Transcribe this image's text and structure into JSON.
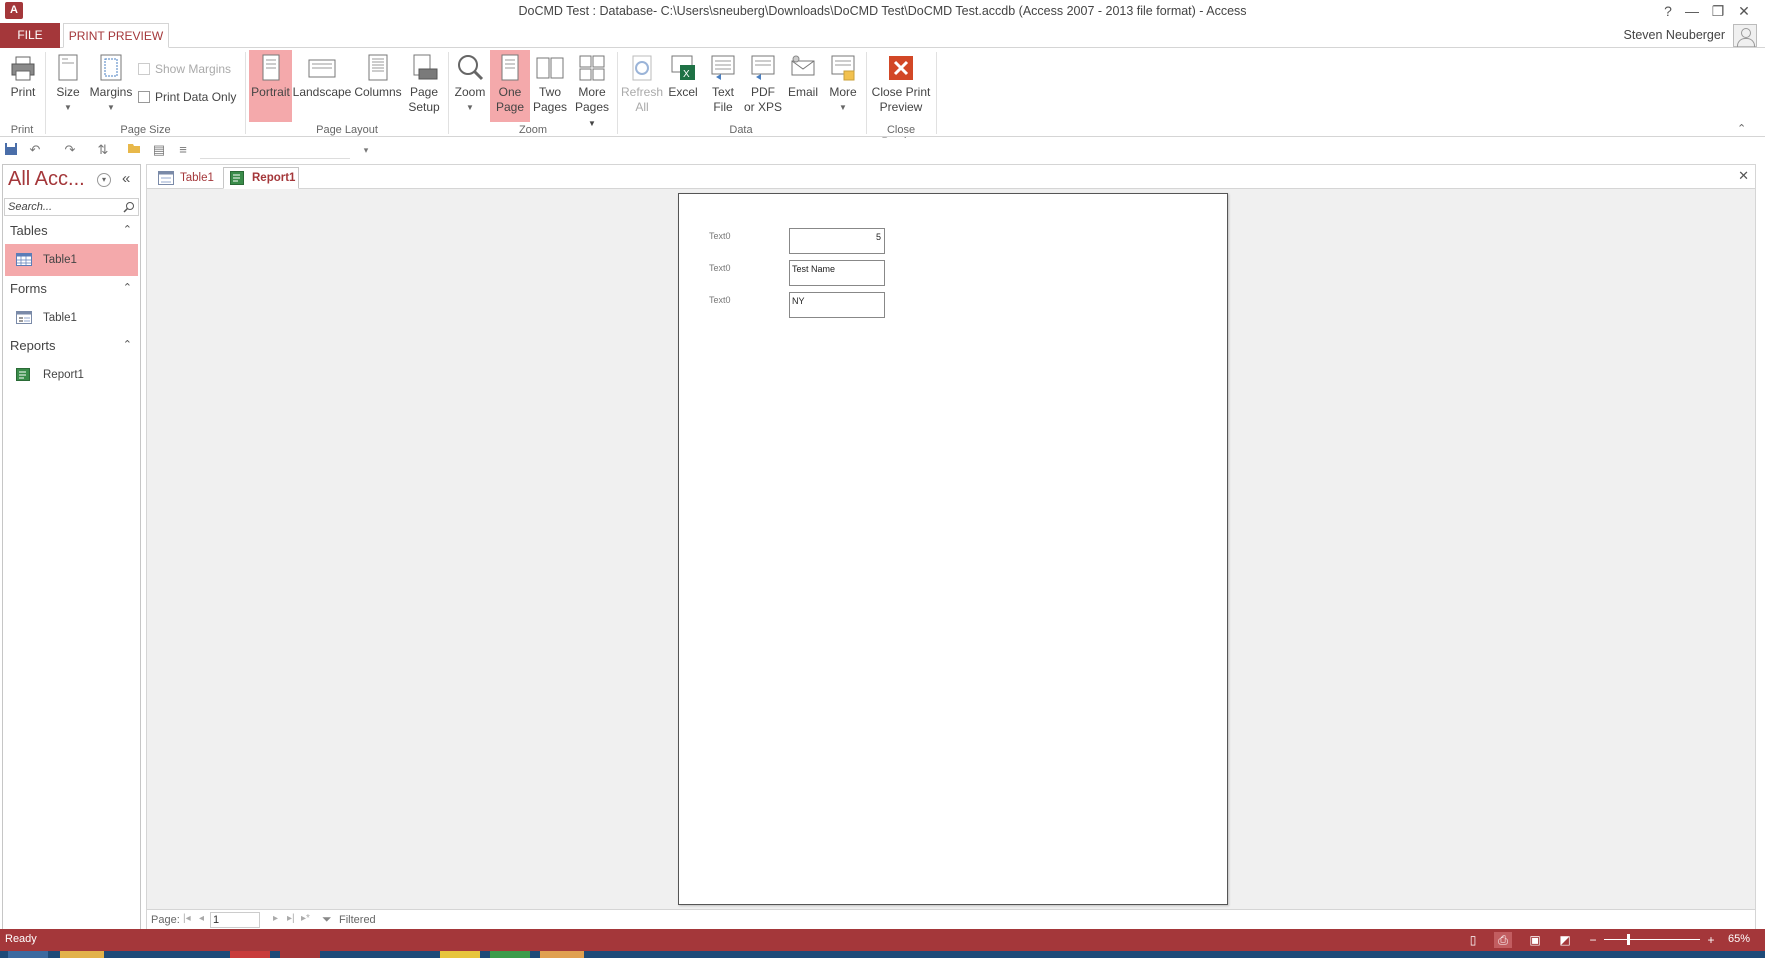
{
  "titlebar": {
    "title": "DoCMD Test : Database- C:\\Users\\sneuberg\\Downloads\\DoCMD Test\\DoCMD Test.accdb (Access 2007 - 2013 file format) - Access",
    "app_icon": "A",
    "help": "?",
    "minimize": "—",
    "restore": "❐",
    "close": "✕"
  },
  "tabs": {
    "file": "FILE",
    "print_preview": "PRINT PREVIEW",
    "user": "Steven Neuberger"
  },
  "ribbon": {
    "print": "Print",
    "size": "Size",
    "margins": "Margins",
    "show_margins": "Show Margins",
    "print_data_only": "Print Data Only",
    "portrait": "Portrait",
    "landscape": "Landscape",
    "columns": "Columns",
    "page_setup_1": "Page",
    "page_setup_2": "Setup",
    "zoom": "Zoom",
    "one_page_1": "One",
    "one_page_2": "Page",
    "two_pages_1": "Two",
    "two_pages_2": "Pages",
    "more_pages_1": "More",
    "more_pages_2": "Pages",
    "refresh_1": "Refresh",
    "refresh_2": "All",
    "excel": "Excel",
    "text_file_1": "Text",
    "text_file_2": "File",
    "pdf_1": "PDF",
    "pdf_2": "or XPS",
    "email": "Email",
    "more": "More",
    "close_preview_1": "Close Print",
    "close_preview_2": "Preview",
    "groups": {
      "print": "Print",
      "page_size": "Page Size",
      "page_layout": "Page Layout",
      "zoom": "Zoom",
      "data": "Data",
      "close_preview": "Close Preview"
    }
  },
  "nav": {
    "title": "All Acc...",
    "search_placeholder": "Search...",
    "groups": [
      {
        "label": "Tables",
        "items": [
          {
            "label": "Table1"
          }
        ]
      },
      {
        "label": "Forms",
        "items": [
          {
            "label": "Table1"
          }
        ]
      },
      {
        "label": "Reports",
        "items": [
          {
            "label": "Report1"
          }
        ]
      }
    ]
  },
  "doc": {
    "tabs": [
      {
        "label": "Table1"
      },
      {
        "label": "Report1"
      }
    ],
    "report": {
      "rows": [
        {
          "label": "Text0",
          "value": "5"
        },
        {
          "label": "Text0",
          "value": "Test Name"
        },
        {
          "label": "Text0",
          "value": "NY"
        }
      ]
    },
    "record_nav": {
      "label": "Page:",
      "page": "1",
      "filter": "Filtered"
    }
  },
  "statusbar": {
    "ready": "Ready",
    "zoom": "65%"
  },
  "colors": {
    "accent": "#a4373a",
    "active_button": "#f4a9ab"
  }
}
